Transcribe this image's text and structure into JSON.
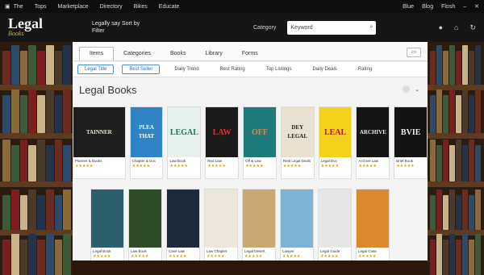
{
  "topbar": {
    "icon": "app-icon",
    "menu": [
      "The",
      "Tops",
      "Marketplace",
      "Directory",
      "Bikes",
      "Educate"
    ],
    "right": [
      "Blue",
      "Blog",
      "Flosh"
    ]
  },
  "header": {
    "logo_main": "Legal",
    "logo_sub": "Books",
    "tagline": "Legally say Sort by Filter",
    "category_label": "Category",
    "search_placeholder": "Keyword"
  },
  "tabs": [
    "Items",
    "Categories",
    "Books",
    "Library",
    "Forms"
  ],
  "tab_active": 0,
  "filters": [
    "Legal Title",
    "Best Seller",
    "Daily Trend",
    "Best Rating",
    "Top Listings",
    "Daily Deals",
    "Rating"
  ],
  "filter_active": 0,
  "section": {
    "title": "Legal Books"
  },
  "row1": [
    {
      "cover": "TAINNER",
      "title": "Planner & Books",
      "bg": "#1e1e1e",
      "fg": "#f0e6c8"
    },
    {
      "cover": "PLEA THAT",
      "title": "Chapter & Doc",
      "bg": "#2f84c6",
      "fg": "#fff"
    },
    {
      "cover": "LEGAL",
      "title": "Law Book",
      "bg": "#e6f1ee",
      "fg": "#2a6d5d"
    },
    {
      "cover": "LAW",
      "title": "Red Law",
      "bg": "#1a1a1a",
      "fg": "#d33"
    },
    {
      "cover": "OFF",
      "title": "Off & Law",
      "bg": "#1d7b7a",
      "fg": "#d84"
    },
    {
      "cover": "DEY LEGAL",
      "title": "Real Legal Deals",
      "bg": "#e8e0d0",
      "fg": "#222"
    },
    {
      "cover": "LEAL",
      "title": "Legal Doc",
      "bg": "#f2d21a",
      "fg": "#b21d1d"
    },
    {
      "cover": "ARCHIVE",
      "title": "Archive Law",
      "bg": "#151515",
      "fg": "#e8e8e8"
    },
    {
      "cover": "BVIE",
      "title": "Brief Book",
      "bg": "#141414",
      "fg": "#eee"
    }
  ],
  "row2": [
    {
      "cover": "",
      "title": "Legal Book",
      "bg": "#2b5f6d",
      "fg": "#fff"
    },
    {
      "cover": "",
      "title": "Law Book",
      "bg": "#2e4c2a",
      "fg": "#fff"
    },
    {
      "cover": "",
      "title": "Case Law",
      "bg": "#1c2a3a",
      "fg": "#fff"
    },
    {
      "cover": "",
      "title": "Law Chapter",
      "bg": "#ece7de",
      "fg": "#444"
    },
    {
      "cover": "",
      "title": "Legal Desert",
      "bg": "#caa874",
      "fg": "#3a2a12"
    },
    {
      "cover": "",
      "title": "Lawyer",
      "bg": "#7fb3d6",
      "fg": "#123"
    },
    {
      "cover": "",
      "title": "Legal Guide",
      "bg": "#e6e6e6",
      "fg": "#222"
    },
    {
      "cover": "",
      "title": "Legal Case",
      "bg": "#d98a2e",
      "fg": "#fff"
    }
  ]
}
